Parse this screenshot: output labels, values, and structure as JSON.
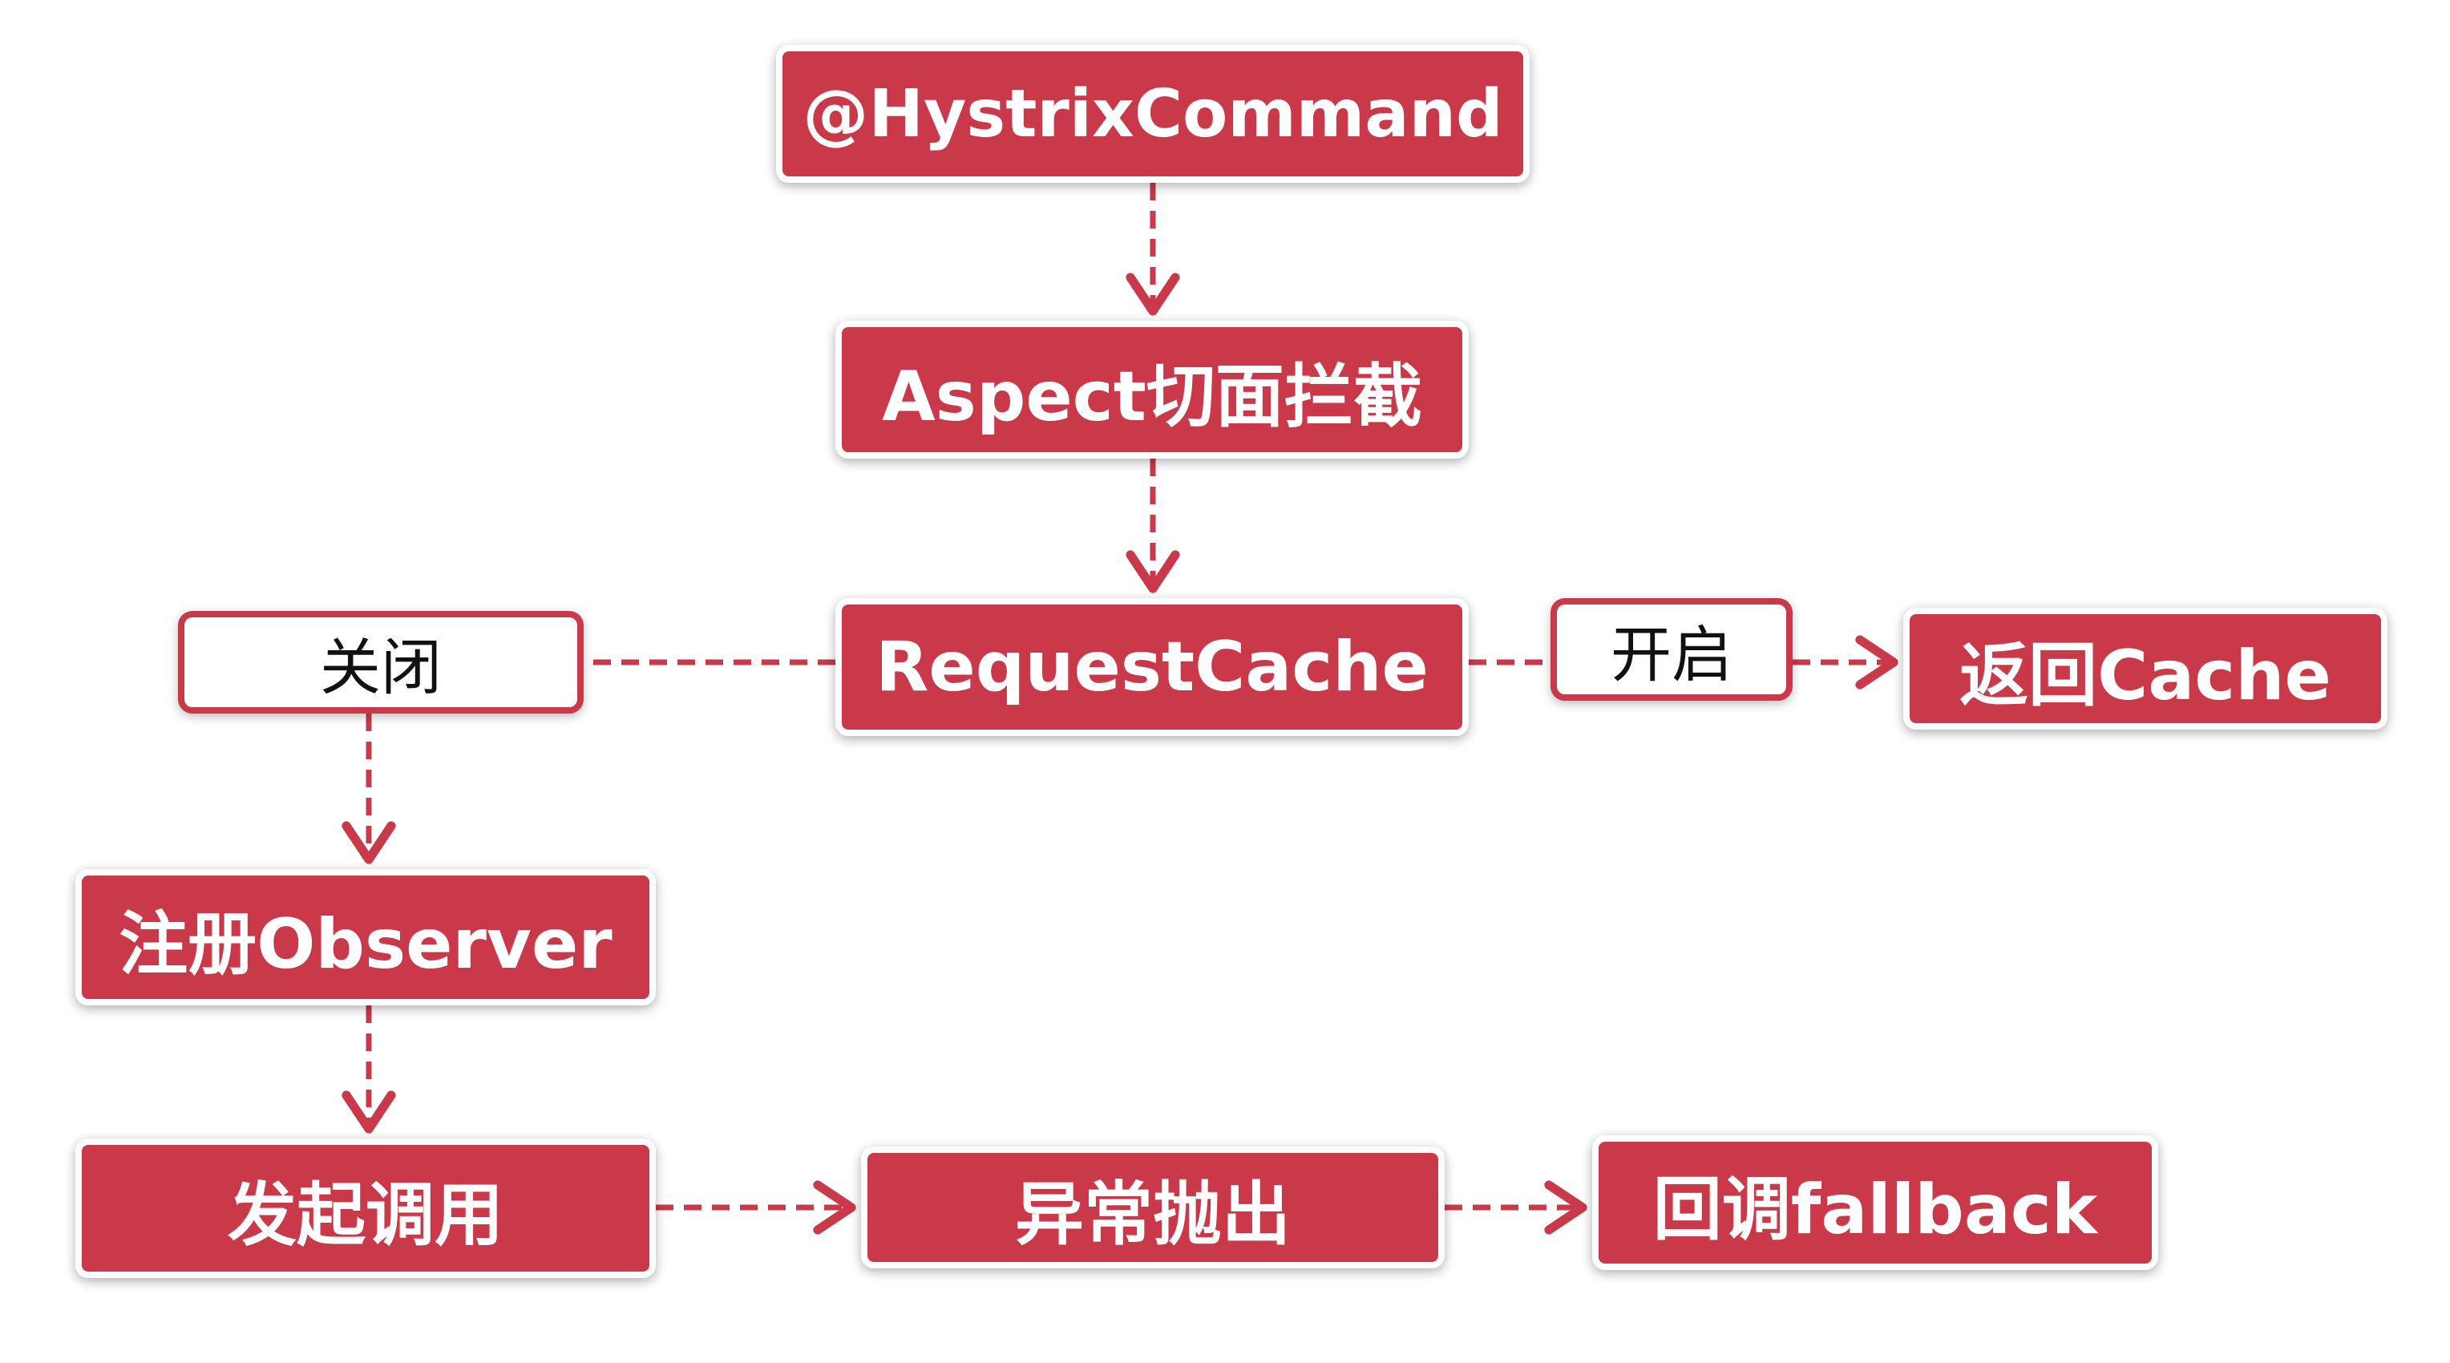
{
  "colors": {
    "accent": "#c9394a",
    "node_text": "#ffffff",
    "label_text": "#111111",
    "background": "#ffffff"
  },
  "nodes": {
    "hystrix_command": "@HystrixCommand",
    "aspect_intercept": "Aspect切面拦截",
    "request_cache": "RequestCache",
    "return_cache": "返回Cache",
    "register_observer": "注册Observer",
    "invoke_call": "发起调用",
    "exception_thrown": "异常抛出",
    "fallback_callback": "回调fallback"
  },
  "edge_labels": {
    "cache_closed": "关闭",
    "cache_open": "开启"
  }
}
